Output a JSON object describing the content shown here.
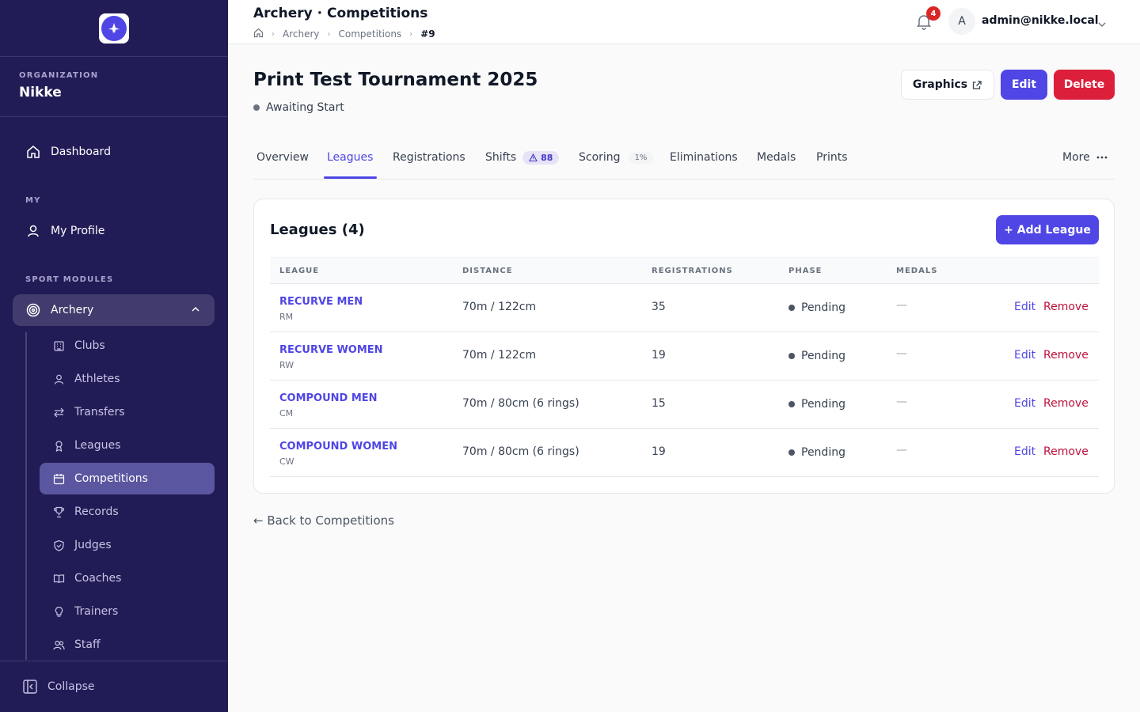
{
  "sidebar": {
    "org_label": "ORGANIZATION",
    "org_name": "Nikke",
    "dashboard": "Dashboard",
    "my_label": "MY",
    "my_profile": "My Profile",
    "sport_label": "SPORT MODULES",
    "archery": "Archery",
    "sub_items": [
      "Clubs",
      "Athletes",
      "Transfers",
      "Leagues",
      "Competitions",
      "Records",
      "Judges",
      "Coaches",
      "Trainers",
      "Staff"
    ],
    "active_sub": "Competitions",
    "collapse": "Collapse"
  },
  "topbar": {
    "title": "Archery · Competitions",
    "crumbs": [
      "Archery",
      "Competitions"
    ],
    "crumb_current": "#9",
    "notifications": "4",
    "avatar_initial": "A",
    "user_email": "admin@nikke.local"
  },
  "header": {
    "title": "Print Test Tournament 2025",
    "status": "Awaiting Start",
    "graphics": "Graphics",
    "edit": "Edit",
    "delete": "Delete"
  },
  "tabs": {
    "overview": "Overview",
    "leagues": "Leagues",
    "registrations": "Registrations",
    "shifts": "Shifts",
    "shifts_badge": "88",
    "scoring": "Scoring",
    "scoring_badge": "1%",
    "eliminations": "Eliminations",
    "medals": "Medals",
    "prints": "Prints",
    "more": "More",
    "active": "Leagues"
  },
  "leagues_card": {
    "title": "Leagues (4)",
    "add_button": "+ Add League",
    "columns": [
      "LEAGUE",
      "DISTANCE",
      "REGISTRATIONS",
      "PHASE",
      "MEDALS"
    ],
    "rows": [
      {
        "name": "RECURVE MEN",
        "code": "RM",
        "distance": "70m / 122cm",
        "registrations": "35",
        "phase": "Pending",
        "medals": "—",
        "edit": "Edit",
        "remove": "Remove"
      },
      {
        "name": "RECURVE WOMEN",
        "code": "RW",
        "distance": "70m / 122cm",
        "registrations": "19",
        "phase": "Pending",
        "medals": "—",
        "edit": "Edit",
        "remove": "Remove"
      },
      {
        "name": "COMPOUND MEN",
        "code": "CM",
        "distance": "70m / 80cm (6 rings)",
        "registrations": "15",
        "phase": "Pending",
        "medals": "—",
        "edit": "Edit",
        "remove": "Remove"
      },
      {
        "name": "COMPOUND WOMEN",
        "code": "CW",
        "distance": "70m / 80cm (6 rings)",
        "registrations": "19",
        "phase": "Pending",
        "medals": "—",
        "edit": "Edit",
        "remove": "Remove"
      }
    ]
  },
  "back_link": "← Back to Competitions",
  "colors": {
    "sidebar_bg": "#221c56",
    "accent": "#4f46e5",
    "danger": "#dc1f3a"
  }
}
